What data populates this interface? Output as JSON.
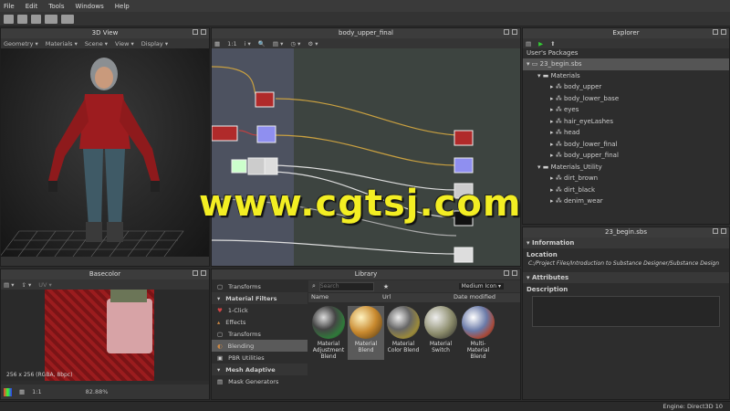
{
  "menu": [
    "File",
    "Edit",
    "Tools",
    "Windows",
    "Help"
  ],
  "view3d": {
    "title": "3D View",
    "sub": [
      "Geometry ▾",
      "Materials ▾",
      "Scene ▾",
      "View ▾",
      "Display ▾"
    ]
  },
  "graph": {
    "title": "body_upper_final"
  },
  "explorer": {
    "title": "Explorer",
    "section": "User's Packages",
    "package": "23_begin.sbs",
    "tree": [
      {
        "label": "Materials",
        "level": 1,
        "type": "folder"
      },
      {
        "label": "body_upper",
        "level": 2,
        "type": "graph"
      },
      {
        "label": "body_lower_base",
        "level": 2,
        "type": "graph"
      },
      {
        "label": "eyes",
        "level": 2,
        "type": "graph"
      },
      {
        "label": "hair_eyeLashes",
        "level": 2,
        "type": "graph"
      },
      {
        "label": "head",
        "level": 2,
        "type": "graph"
      },
      {
        "label": "body_lower_final",
        "level": 2,
        "type": "graph"
      },
      {
        "label": "body_upper_final",
        "level": 2,
        "type": "graph"
      },
      {
        "label": "Materials_Utility",
        "level": 1,
        "type": "folder"
      },
      {
        "label": "dirt_brown",
        "level": 2,
        "type": "graph"
      },
      {
        "label": "dirt_black",
        "level": 2,
        "type": "graph"
      },
      {
        "label": "denim_wear",
        "level": 2,
        "type": "graph"
      }
    ]
  },
  "basecolor": {
    "title": "Basecolor",
    "uv": "UV ▾",
    "info": "256 x 256 (RGBA, 8bpc)",
    "zoom": "82.88%",
    "ratio": "1:1"
  },
  "library": {
    "title": "Library",
    "search_placeholder": "Search",
    "size": "Medium Icon ▾",
    "cols": [
      "Name",
      "Url",
      "Date modified"
    ],
    "cats": [
      {
        "label": "Transforms",
        "head": false,
        "sel": false
      },
      {
        "label": "Material Filters",
        "head": true,
        "sel": false
      },
      {
        "label": "1-Click",
        "head": false,
        "sel": false
      },
      {
        "label": "Effects",
        "head": false,
        "sel": false
      },
      {
        "label": "Transforms",
        "head": false,
        "sel": false
      },
      {
        "label": "Blending",
        "head": false,
        "sel": true
      },
      {
        "label": "PBR Utilities",
        "head": false,
        "sel": false
      },
      {
        "label": "Mesh Adaptive",
        "head": true,
        "sel": false
      },
      {
        "label": "Mask Generators",
        "head": false,
        "sel": false
      }
    ],
    "items": [
      {
        "label": "Material Adjustment Blend",
        "color": "#2f7a3a"
      },
      {
        "label": "Material Blend",
        "color": "#c8892e"
      },
      {
        "label": "Material Color Blend",
        "color": "#9b8a3a"
      },
      {
        "label": "Material Switch",
        "color": "#8a8a6a"
      },
      {
        "label": "Multi-Material Blend",
        "color": "#6a7aa8"
      }
    ]
  },
  "props": {
    "title": "23_begin.sbs",
    "info": "Information",
    "location_label": "Location",
    "location": "C:/Project Files/Introduction to Substance Designer/Substance Design",
    "attributes": "Attributes",
    "description": "Description"
  },
  "status": {
    "engine": "Engine: Direct3D 10"
  },
  "watermark": "www.cgtsj.com"
}
